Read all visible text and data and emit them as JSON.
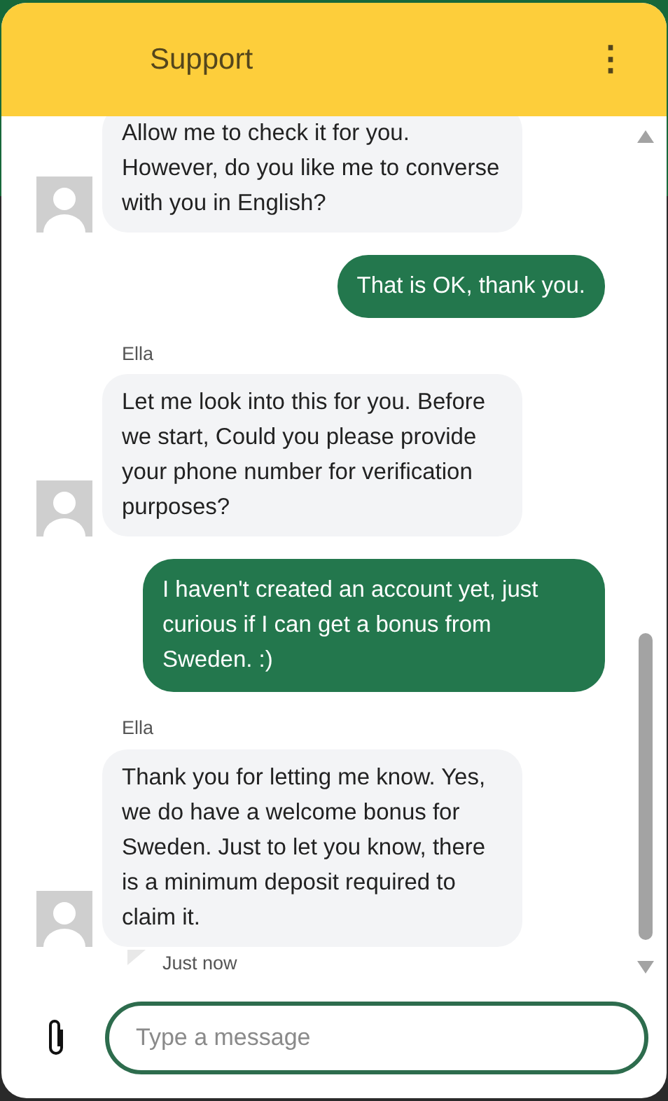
{
  "header": {
    "title": "Support",
    "menu_icon": "⋮"
  },
  "messages": [
    {
      "kind": "agent",
      "text": "Allow me to check it for you. However, do you like me to converse with you in English?"
    },
    {
      "kind": "user",
      "text": "That is OK, thank you."
    },
    {
      "kind": "agent",
      "sender": "Ella",
      "text": "Let me look into this for you. Before we start, Could you please provide your phone number for verification purposes?"
    },
    {
      "kind": "user",
      "text": "I haven't created an account yet, just curious if I can get a bonus from Sweden. :)"
    },
    {
      "kind": "agent",
      "sender": "Ella",
      "text": "Thank you for letting me know. Yes, we do have a welcome bonus for Sweden. Just to let you know, there is a minimum deposit required to claim it.",
      "time": "Just now"
    }
  ],
  "composer": {
    "placeholder": "Type a message"
  }
}
